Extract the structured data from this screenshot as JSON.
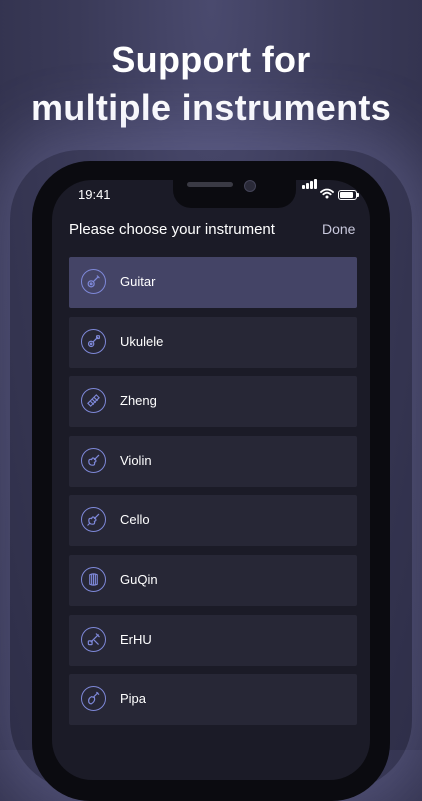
{
  "headline": {
    "line1": "Support for",
    "line2": "multiple instruments"
  },
  "status_bar": {
    "time": "19:41"
  },
  "header": {
    "title": "Please choose your instrument",
    "done_label": "Done"
  },
  "colors": {
    "background": "#3a3a58",
    "screen": "#1b1b27",
    "row": "#272736",
    "row_selected": "#444466",
    "icon_accent": "#7e88d8"
  },
  "instruments": [
    {
      "label": "Guitar",
      "icon": "guitar-icon",
      "selected": true
    },
    {
      "label": "Ukulele",
      "icon": "ukulele-icon",
      "selected": false
    },
    {
      "label": "Zheng",
      "icon": "zheng-icon",
      "selected": false
    },
    {
      "label": "Violin",
      "icon": "violin-icon",
      "selected": false
    },
    {
      "label": "Cello",
      "icon": "cello-icon",
      "selected": false
    },
    {
      "label": "GuQin",
      "icon": "guqin-icon",
      "selected": false
    },
    {
      "label": "ErHU",
      "icon": "erhu-icon",
      "selected": false
    },
    {
      "label": "Pipa",
      "icon": "pipa-icon",
      "selected": false
    }
  ]
}
